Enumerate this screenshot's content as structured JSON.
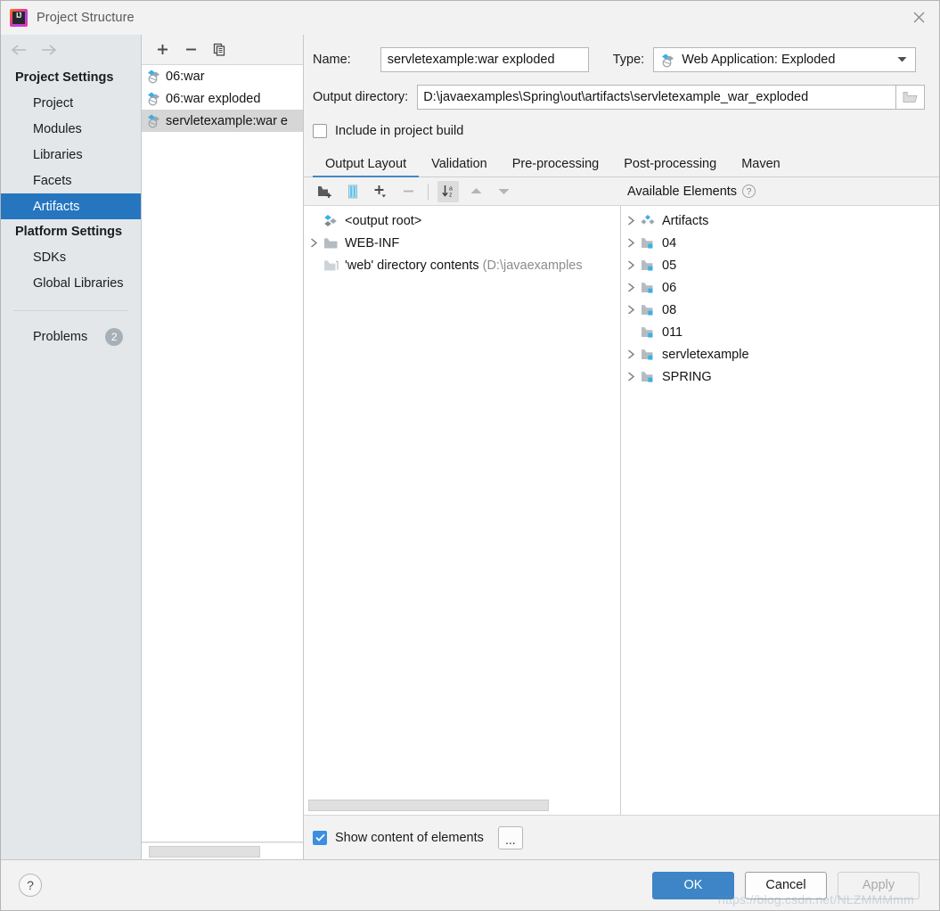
{
  "window": {
    "title": "Project Structure",
    "logo_icon": "intellij-idea-logo",
    "close_icon": "close-icon"
  },
  "sidebar": {
    "nav": {
      "back_icon": "arrow-left-icon",
      "forward_icon": "arrow-right-icon"
    },
    "groups": [
      {
        "label": "Project Settings",
        "items": [
          {
            "label": "Project",
            "selected": false
          },
          {
            "label": "Modules",
            "selected": false
          },
          {
            "label": "Libraries",
            "selected": false
          },
          {
            "label": "Facets",
            "selected": false
          },
          {
            "label": "Artifacts",
            "selected": true
          }
        ]
      },
      {
        "label": "Platform Settings",
        "items": [
          {
            "label": "SDKs",
            "selected": false
          },
          {
            "label": "Global Libraries",
            "selected": false
          }
        ]
      }
    ],
    "problems": {
      "label": "Problems",
      "count": "2"
    }
  },
  "artifact_panel": {
    "toolbar": [
      {
        "name": "add-artifact-button",
        "icon": "plus-icon"
      },
      {
        "name": "remove-artifact-button",
        "icon": "minus-icon"
      },
      {
        "name": "copy-artifact-button",
        "icon": "copy-icon"
      }
    ],
    "items": [
      {
        "label": "06:war",
        "icon": "artifact-war-icon",
        "selected": false
      },
      {
        "label": "06:war exploded",
        "icon": "artifact-war-exploded-icon",
        "selected": false
      },
      {
        "label": "servletexample:war e",
        "icon": "artifact-war-exploded-icon",
        "selected": true
      }
    ]
  },
  "form": {
    "name_label": "Name:",
    "name_value": "servletexample:war exploded",
    "type_label": "Type:",
    "type_value": "Web Application: Exploded",
    "type_icon": "artifact-war-exploded-icon",
    "type_carat_icon": "chevron-down-icon",
    "output_dir_label": "Output directory:",
    "output_dir_value": "D:\\javaexamples\\Spring\\out\\artifacts\\servletexample_war_exploded",
    "output_dir_browse_icon": "folder-open-icon",
    "include_in_build_label": "Include in project build",
    "include_in_build_checked": false
  },
  "tabs": [
    {
      "label": "Output Layout",
      "active": true
    },
    {
      "label": "Validation",
      "active": false
    },
    {
      "label": "Pre-processing",
      "active": false
    },
    {
      "label": "Post-processing",
      "active": false
    },
    {
      "label": "Maven",
      "active": false
    }
  ],
  "layout_toolbar": {
    "buttons": [
      {
        "name": "create-directory-button",
        "icon": "folder-add-icon",
        "pressed": false,
        "disabled": false
      },
      {
        "name": "create-archive-button",
        "icon": "archive-icon",
        "pressed": false,
        "disabled": false
      },
      {
        "name": "add-copy-of-button",
        "icon": "plus-dropdown-icon",
        "pressed": false,
        "disabled": false
      },
      {
        "name": "remove-element-button",
        "icon": "minus-icon",
        "pressed": false,
        "disabled": true
      },
      {
        "name": "sort-elements-button",
        "icon": "sort-alpha-down-icon",
        "pressed": true,
        "disabled": false
      },
      {
        "name": "move-up-button",
        "icon": "arrow-up-icon",
        "pressed": false,
        "disabled": true
      },
      {
        "name": "move-down-button",
        "icon": "arrow-down-icon",
        "pressed": false,
        "disabled": true
      }
    ],
    "available_elements_label": "Available Elements",
    "available_elements_help_icon": "help-icon",
    "help_glyph": "?"
  },
  "output_layout_tree": [
    {
      "label": "<output root>",
      "icon": "artifact-output-root-icon",
      "arrow": "none",
      "indent": 0,
      "suffix": ""
    },
    {
      "label": "WEB-INF",
      "icon": "folder-icon",
      "arrow": "collapsed",
      "indent": 0,
      "suffix": ""
    },
    {
      "label": "'web' directory contents",
      "icon": "folder-copy-icon",
      "arrow": "none",
      "indent": 0,
      "suffix": "(D:\\javaexamples"
    }
  ],
  "available_elements_tree": [
    {
      "label": "Artifacts",
      "icon": "artifact-group-icon",
      "arrow": "collapsed"
    },
    {
      "label": "04",
      "icon": "module-icon",
      "arrow": "collapsed"
    },
    {
      "label": "05",
      "icon": "module-icon",
      "arrow": "collapsed"
    },
    {
      "label": "06",
      "icon": "module-icon",
      "arrow": "collapsed"
    },
    {
      "label": "08",
      "icon": "module-icon",
      "arrow": "collapsed"
    },
    {
      "label": "011",
      "icon": "module-icon",
      "arrow": "none"
    },
    {
      "label": "servletexample",
      "icon": "module-icon",
      "arrow": "collapsed"
    },
    {
      "label": "SPRING",
      "icon": "module-icon",
      "arrow": "collapsed"
    }
  ],
  "bottom": {
    "show_content_label": "Show content of elements",
    "show_content_checked": true,
    "more_options_label": "..."
  },
  "footer": {
    "help_glyph": "?",
    "ok_label": "OK",
    "cancel_label": "Cancel",
    "apply_label": "Apply",
    "apply_disabled": true
  },
  "watermark": "https://blog.csdn.net/NLZMMMmm",
  "colors": {
    "accent_blue": "#2675bf",
    "button_blue": "#3d85c6",
    "checkbox_blue": "#3b8ee0",
    "sidebar_bg": "#e3e7ea",
    "panel_bg": "#f2f2f2"
  }
}
